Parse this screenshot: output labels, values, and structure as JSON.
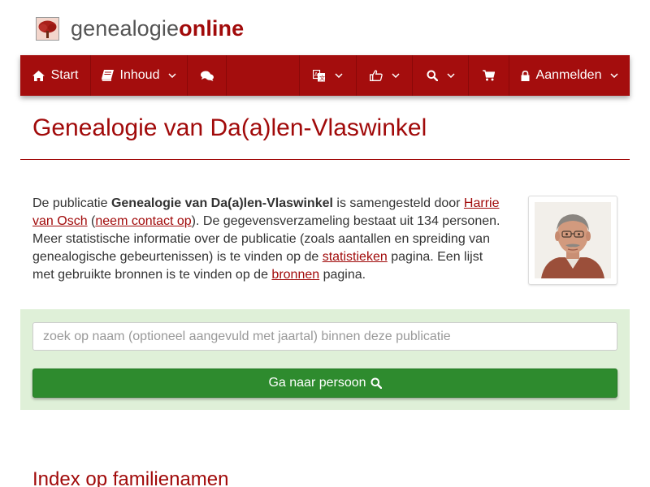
{
  "brand": {
    "name_prefix": "genealogie",
    "name_suffix": "online"
  },
  "navbar": {
    "start_label": "Start",
    "content_label": "Inhoud",
    "login_label": "Aanmelden",
    "icons": [
      "home-icon",
      "book-icon",
      "comments-icon",
      "translate-icon",
      "thumbs-up-icon",
      "search-icon",
      "cart-icon",
      "lock-icon"
    ]
  },
  "page": {
    "title": "Genealogie van Da(a)len-Vlaswinkel"
  },
  "intro": {
    "t1": "De publicatie ",
    "publication": "Genealogie van Da(a)len-Vlaswinkel",
    "t2": " is samengesteld door ",
    "author": "Harrie van Osch",
    "t3": " (",
    "contact": "neem contact op",
    "t4": "). De gegevensverzameling bestaat uit 134 personen. Meer statistische informatie over de publicatie (zoals aantallen en spreiding van genealogische gebeurtenissen) is te vinden op de ",
    "statistics": "statistieken",
    "t5": " pagina. Een lijst met gebruikte bronnen is te vinden op de ",
    "sources": "bronnen",
    "t6": " pagina."
  },
  "search": {
    "placeholder": "zoek op naam (optioneel aangevuld met jaartal) binnen deze publicatie",
    "value": "",
    "button_label": "Ga naar persoon"
  },
  "section": {
    "heading": "Index op familienamen"
  },
  "colors": {
    "brand_red": "#a40d0d",
    "accent_text": "#a10a0a",
    "panel_green": "#dff0d8",
    "button_green": "#2e8b2e"
  }
}
